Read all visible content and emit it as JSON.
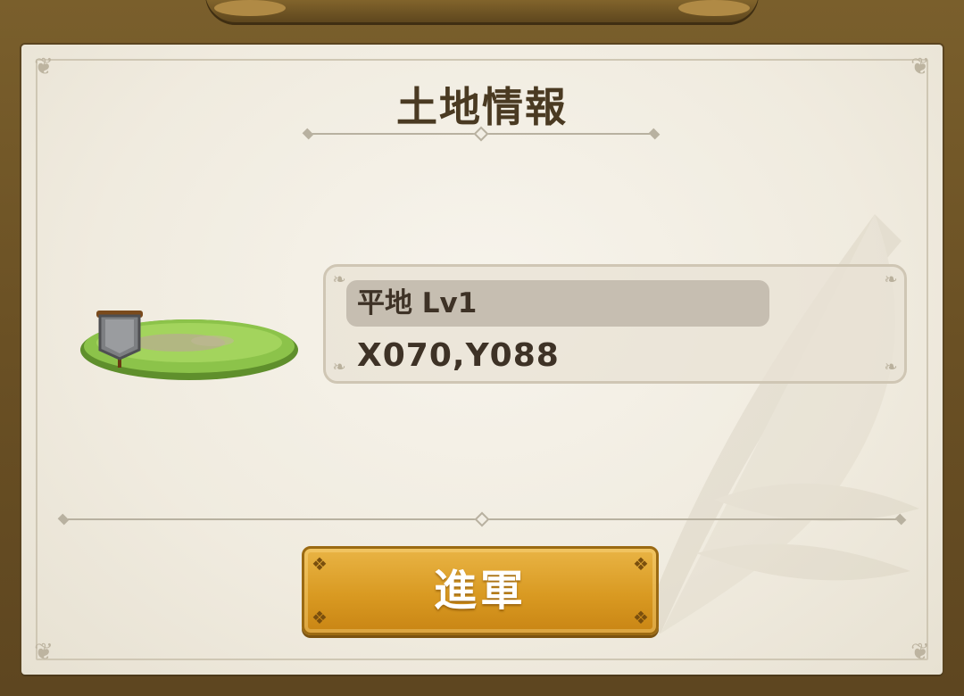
{
  "dialog": {
    "title": "土地情報"
  },
  "tile": {
    "terrain": "平地 Lv1",
    "coordinates": "X070,Y088",
    "icon": "territory-banner-icon"
  },
  "actions": {
    "march_label": "進軍"
  },
  "colors": {
    "frame": "#6b5326",
    "panel": "#f2eee4",
    "title_text": "#4a3a22",
    "button": "#d99a22",
    "terrain_badge": "#c6beb1"
  }
}
